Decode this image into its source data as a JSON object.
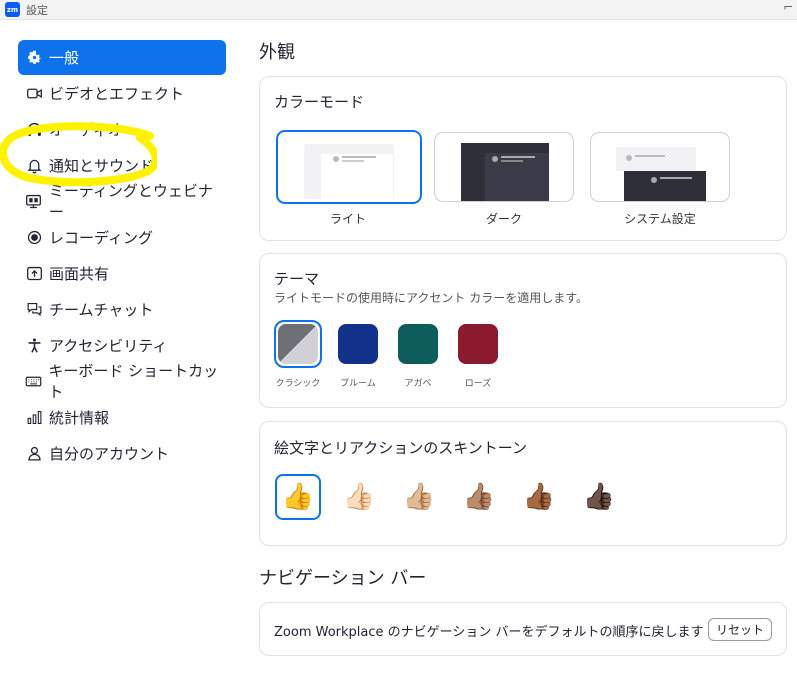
{
  "window": {
    "title": "設定",
    "logo": "zm"
  },
  "sidebar": {
    "items": [
      {
        "label": "一般",
        "icon": "gear-icon",
        "active": true
      },
      {
        "label": "ビデオとエフェクト",
        "icon": "video-icon"
      },
      {
        "label": "オーディオ",
        "icon": "headphones-icon"
      },
      {
        "label": "通知とサウンド",
        "icon": "bell-icon"
      },
      {
        "label": "ミーティングとウェビナー",
        "icon": "meeting-icon"
      },
      {
        "label": "レコーディング",
        "icon": "record-icon"
      },
      {
        "label": "画面共有",
        "icon": "share-screen-icon"
      },
      {
        "label": "チームチャット",
        "icon": "chat-icon"
      },
      {
        "label": "アクセシビリティ",
        "icon": "accessibility-icon"
      },
      {
        "label": "キーボード ショートカット",
        "icon": "keyboard-icon"
      },
      {
        "label": "統計情報",
        "icon": "statistics-icon"
      },
      {
        "label": "自分のアカウント",
        "icon": "account-icon"
      }
    ]
  },
  "main": {
    "appearance_title": "外観",
    "color_mode": {
      "title": "カラーモード",
      "options": [
        {
          "label": "ライト",
          "selected": true
        },
        {
          "label": "ダーク",
          "selected": false
        },
        {
          "label": "システム設定",
          "selected": false
        }
      ]
    },
    "theme": {
      "title": "テーマ",
      "subtitle": "ライトモードの使用時にアクセント カラーを適用します。",
      "options": [
        {
          "label": "クラシック",
          "color": "#6e6e75",
          "selected": true
        },
        {
          "label": "ブルーム",
          "color": "#12318a",
          "selected": false
        },
        {
          "label": "アガベ",
          "color": "#0f5d5a",
          "selected": false
        },
        {
          "label": "ローズ",
          "color": "#8b1a2e",
          "selected": false
        }
      ]
    },
    "skin_tone": {
      "title": "絵文字とリアクションのスキントーン",
      "options": [
        {
          "emoji": "👍",
          "selected": true
        },
        {
          "emoji": "👍🏻",
          "selected": false
        },
        {
          "emoji": "👍🏼",
          "selected": false
        },
        {
          "emoji": "👍🏽",
          "selected": false
        },
        {
          "emoji": "👍🏾",
          "selected": false
        },
        {
          "emoji": "👍🏿",
          "selected": false
        }
      ]
    },
    "navigation_bar": {
      "title": "ナビゲーション バー",
      "description": "Zoom Workplace のナビゲーション バーをデフォルトの順序に戻します",
      "reset_label": "リセット"
    }
  },
  "colors": {
    "accent": "#0e72ed",
    "highlight": "#fff200"
  }
}
